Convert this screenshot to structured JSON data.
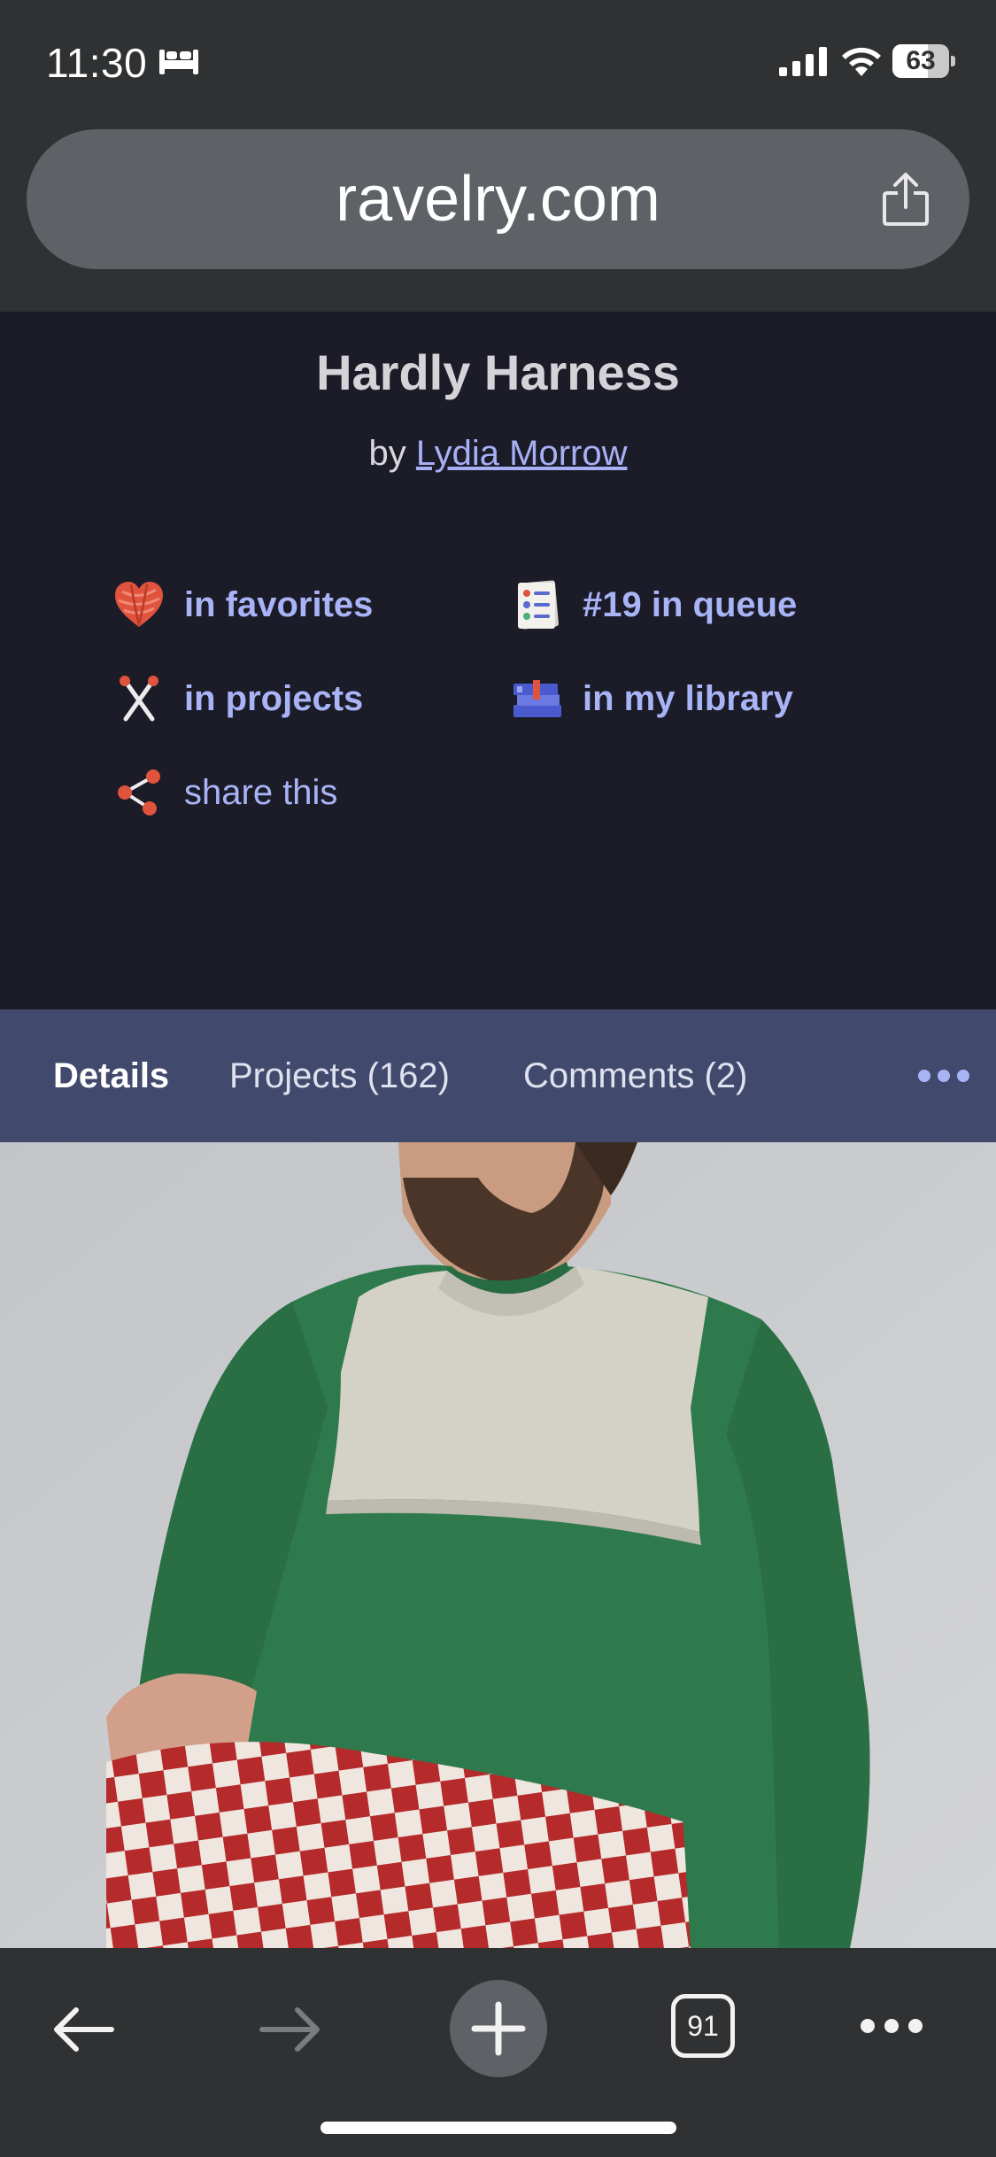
{
  "status_bar": {
    "time": "11:30",
    "battery": "63",
    "battery_level": 0.63,
    "icons": [
      "bed-icon",
      "signal-icon",
      "wifi-icon",
      "battery-icon"
    ]
  },
  "browser": {
    "url": "ravelry.com",
    "tab_count": "91"
  },
  "pattern": {
    "title": "Hardly Harness",
    "by": "by",
    "author": "Lydia Morrow"
  },
  "actions": {
    "favorites": "in favorites",
    "queue": "#19 in queue",
    "projects": "in projects",
    "library": "in my library",
    "share": "share this"
  },
  "tabs": {
    "details": "Details",
    "projects": "Projects (162)",
    "comments": "Comments (2)"
  },
  "colors": {
    "accent_link": "#a9b4f7",
    "tab_bar": "#414a6c",
    "page_bg": "#1b1c28",
    "browser_chrome": "#2f3133"
  }
}
